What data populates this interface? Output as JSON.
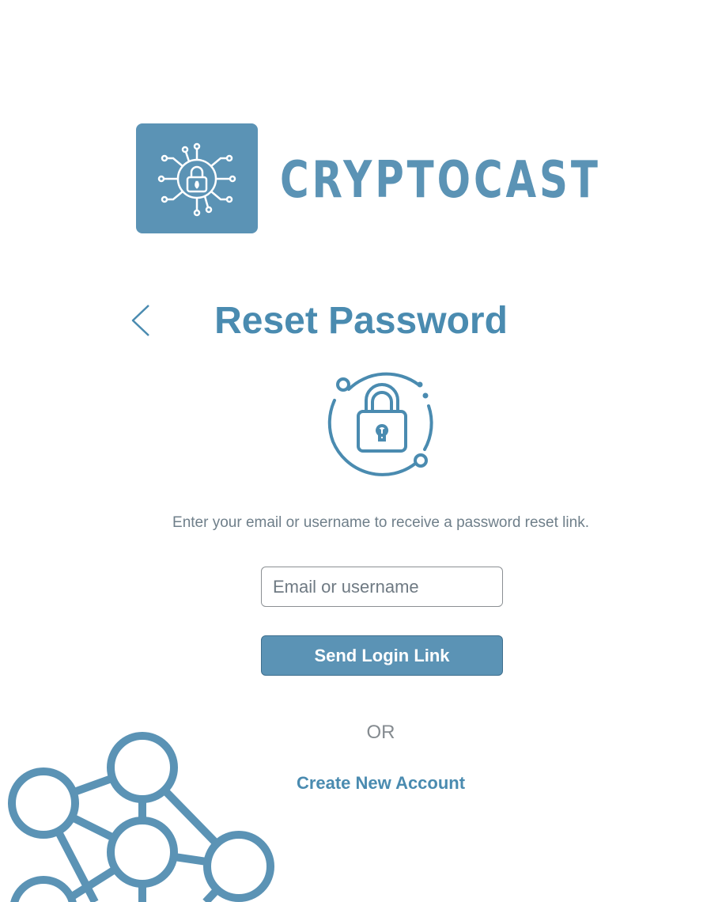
{
  "brand": {
    "name": "CRYPTOCAST",
    "logo_icon": "circuit-lock-icon",
    "accent_color": "#5b93b5"
  },
  "header": {
    "back_icon": "chevron-left-icon",
    "title": "Reset Password"
  },
  "hero_icon": "lock-orbit-icon",
  "form": {
    "instructions": "Enter your email or username to receive a password reset link.",
    "email_placeholder": "Email or username",
    "email_value": "",
    "submit_label": "Send Login Link"
  },
  "alt": {
    "separator": "OR",
    "create_account_label": "Create New Account"
  },
  "decoration": "network-graph-icon"
}
